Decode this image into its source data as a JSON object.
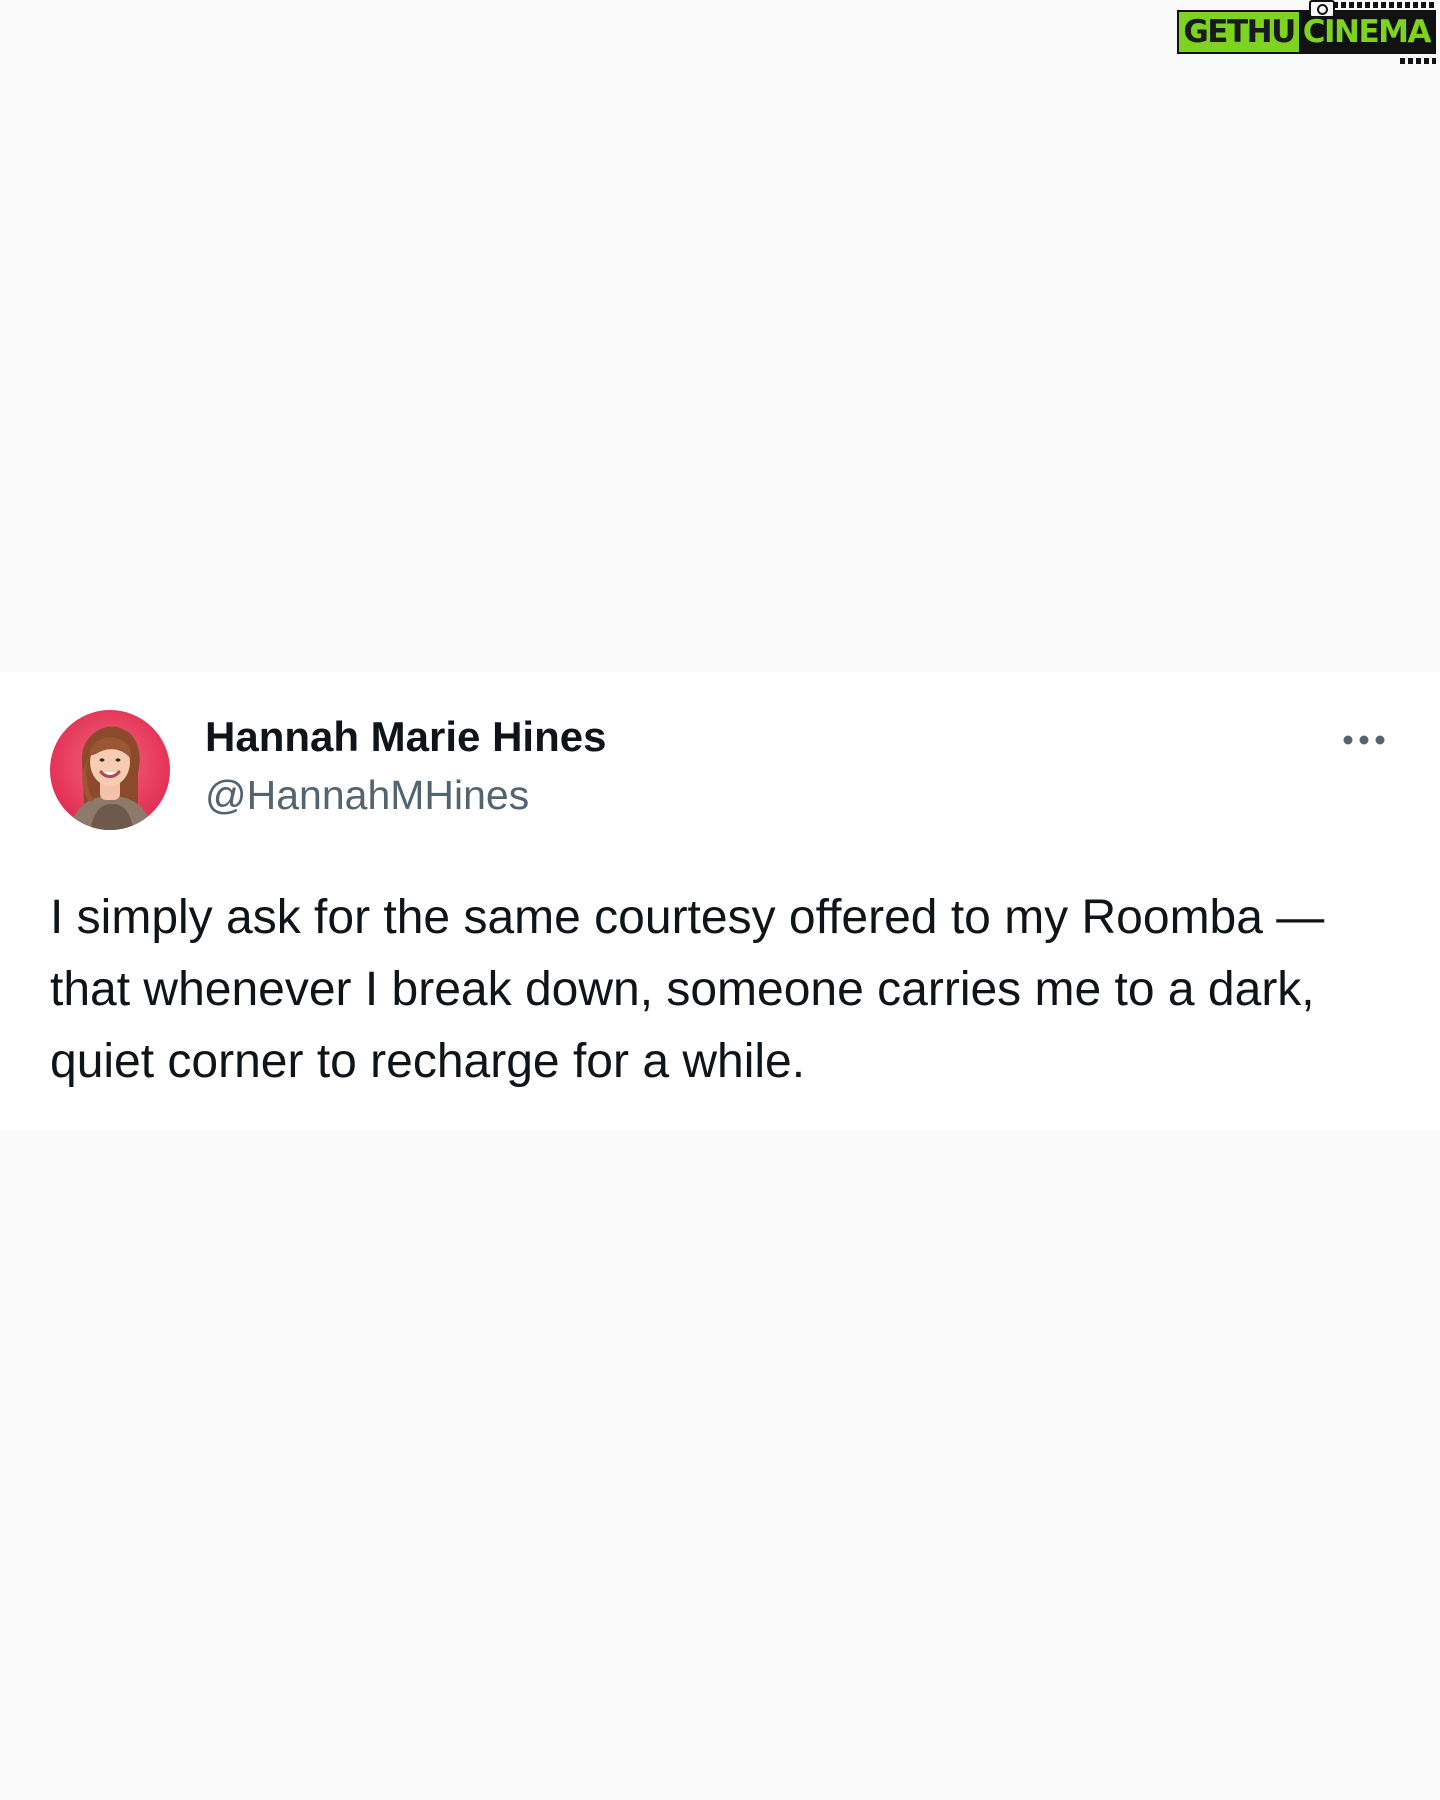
{
  "watermark": {
    "brand_left": "GETHU",
    "brand_right": "CINEMA"
  },
  "tweet": {
    "author": {
      "display_name": "Hannah Marie Hines",
      "handle": "@HannahMHines"
    },
    "more_icon": "more-dots-icon",
    "text": "I simply ask for the same courtesy offered to my Roomba — that whenever I break down, someone carries me to a dark, quiet corner to recharge for a while."
  },
  "colors": {
    "page_background": "#fafafa",
    "card_background": "#ffffff",
    "text_primary": "#0f1419",
    "text_secondary": "#536471",
    "watermark_green": "#7ed321",
    "avatar_ring": "#e8375e"
  }
}
